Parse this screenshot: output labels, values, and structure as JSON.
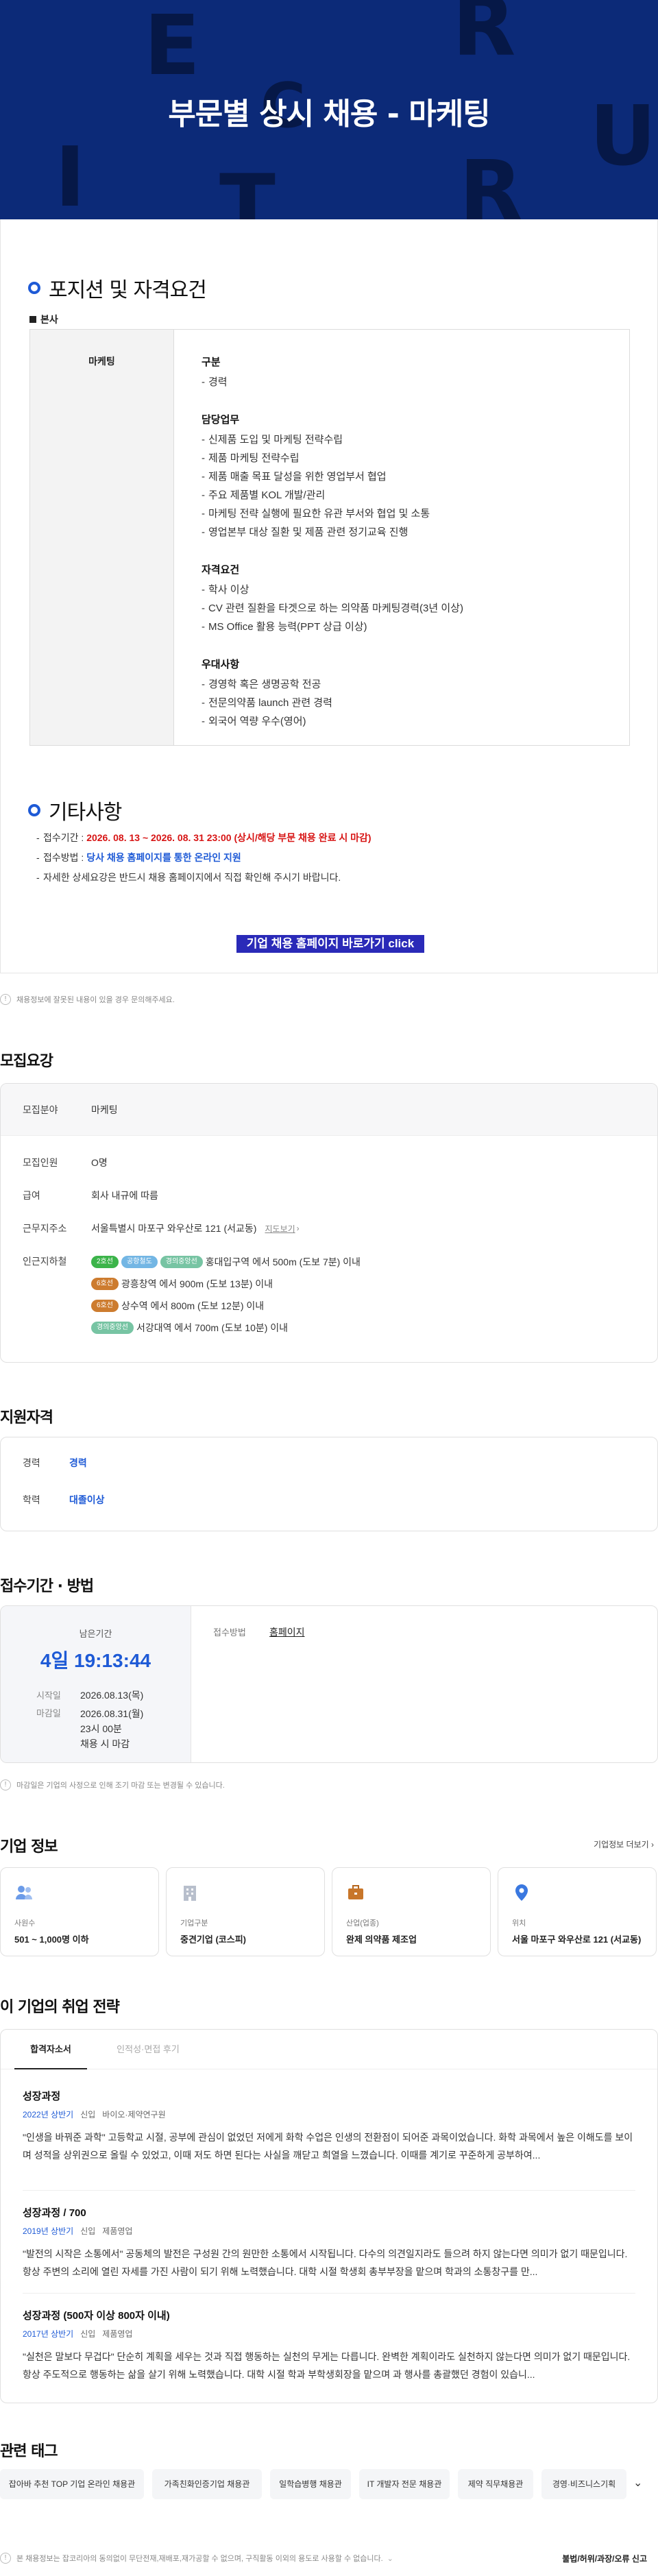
{
  "hero": {
    "title": "부문별 상시 채용 - 마케팅",
    "letters": [
      "E",
      "R",
      "C",
      "U",
      "I",
      "T",
      "R"
    ]
  },
  "positions": {
    "title": "포지션 및 자격요건",
    "division": "본사",
    "role": "마케팅",
    "groups": [
      {
        "heading": "구분",
        "items": [
          "경력"
        ]
      },
      {
        "heading": "담당업무",
        "items": [
          "신제품 도입 및 마케팅 전략수립",
          "제품 마케팅 전략수립",
          "제품 매출 목표 달성을 위한 영업부서 협업",
          "주요 제품별 KOL 개발/관리",
          "마케팅 전략 실행에 필요한 유관 부서와 협업 및 소통",
          "영업본부 대상 질환 및 제품 관련 정기교육 진행"
        ]
      },
      {
        "heading": "자격요건",
        "items": [
          "학사 이상",
          "CV 관련 질환을 타겟으로 하는 의약품 마케팅경력(3년 이상)",
          "MS Office 활용 능력(PPT 상급 이상)"
        ]
      },
      {
        "heading": "우대사항",
        "items": [
          "경영학 혹은 생명공학 전공",
          "전문의약품 launch 관련 경력",
          "외국어 역량 우수(영어)"
        ]
      }
    ]
  },
  "other": {
    "title": "기타사항",
    "period_label": "접수기간 : ",
    "period_value": "2026. 08. 13 ~ 2026. 08. 31 23:00 (상시/해당 부문 채용 완료 시 마감)",
    "method_label": "접수방법 : ",
    "method_value": "당사 채용 홈페이지를 통한 온라인 지원",
    "detail": "자세한 상세요강은 반드시 채용 홈페이지에서 직접 확인해 주시기 바랍니다.",
    "cta": "기업 채용 홈페이지 바로가기 click"
  },
  "notice_posting": "채용정보에 잘못된 내용이 있을 경우 문의해주세요.",
  "summary": {
    "title": "모집요강",
    "rows": [
      {
        "label": "모집분야",
        "value": "마케팅"
      },
      {
        "label": "모집인원",
        "value": "O명"
      },
      {
        "label": "급여",
        "value": "회사 내규에 따름"
      },
      {
        "label": "근무지주소",
        "value": "서울특별시 마포구 와우산로 121 (서교동)"
      }
    ],
    "map_link": "지도보기",
    "nearby_label": "인근지하철",
    "stations": [
      {
        "chips": [
          {
            "text": "2호선",
            "color": "#3cb44a"
          },
          {
            "text": "공항철도",
            "color": "#73b6e4"
          },
          {
            "text": "경의중앙선",
            "color": "#77c4a3"
          }
        ],
        "text": "홍대입구역 에서 500m (도보 7분) 이내"
      },
      {
        "chips": [
          {
            "text": "6호선",
            "color": "#cd7c2f"
          }
        ],
        "text": "광흥창역 에서 900m (도보 13분) 이내"
      },
      {
        "chips": [
          {
            "text": "6호선",
            "color": "#cd7c2f"
          }
        ],
        "text": "상수역 에서 800m (도보 12분) 이내"
      },
      {
        "chips": [
          {
            "text": "경의중앙선",
            "color": "#77c4a3"
          }
        ],
        "text": "서강대역 에서 700m (도보 10분) 이내"
      }
    ]
  },
  "qualification": {
    "title": "지원자격",
    "career_label": "경력",
    "career_value": "경력",
    "edu_label": "학력",
    "edu_value": "대졸이상"
  },
  "apply": {
    "title": "접수기간 · 방법",
    "remain_label": "남은기간",
    "remain_value": "4일 19:13:44",
    "start_label": "시작일",
    "start_value": "2026.08.13(목)",
    "end_label": "마감일",
    "end_value_1": "2026.08.31(월)",
    "end_value_2": "23시 00분",
    "end_value_3": "채용 시 마감",
    "method_label": "접수방법",
    "method_value": "홈페이지",
    "notice": "마감일은 기업의 사정으로 인해 조기 마감 또는 변경될 수 있습니다."
  },
  "company": {
    "title": "기업 정보",
    "more": "기업정보 더보기",
    "cards": [
      {
        "icon": "people-icon",
        "key": "사원수",
        "value": "501 ~ 1,000명 이하"
      },
      {
        "icon": "building-icon",
        "key": "기업구분",
        "value": "중견기업 (코스피)"
      },
      {
        "icon": "briefcase-icon",
        "key": "산업(업종)",
        "value": "완제 의약품 제조업"
      },
      {
        "icon": "location-icon",
        "key": "위치",
        "value": "서울 마포구 와우산로 121 (서교동)"
      }
    ]
  },
  "strategy": {
    "title": "이 기업의 취업 전략",
    "tabs": [
      "합격자소서",
      "인적성·면접 후기"
    ],
    "items": [
      {
        "title": "성장과정",
        "year": "2022년 상반기",
        "type": "신입",
        "dept": "바이오·제약연구원",
        "body": "\"인생을 바꿔준 과학\" 고등학교 시절, 공부에 관심이 없었던 저에게 화학 수업은 인생의 전환점이 되어준 과목이었습니다. 화학 과목에서 높은 이해도를 보이며 성적을 상위권으로 올릴 수 있었고, 이때 저도 하면 된다는 사실을 깨닫고 희열을 느꼈습니다. 이때를 계기로 꾸준하게 공부하여..."
      },
      {
        "title": "성장과정 / 700",
        "year": "2019년 상반기",
        "type": "신입",
        "dept": "제품영업",
        "body": "\"발전의 시작은 소통에서\" 공동체의 발전은 구성원 간의 원만한 소통에서 시작됩니다. 다수의 의견일지라도 들으려 하지 않는다면 의미가 없기 때문입니다. 항상 주변의 소리에 열린 자세를 가진 사람이 되기 위해 노력했습니다. 대학 시절 학생회 총부부장을 맡으며 학과의 소통창구를 만..."
      },
      {
        "title": "성장과정 (500자 이상 800자 이내)",
        "year": "2017년 상반기",
        "type": "신입",
        "dept": "제품영업",
        "body": "\"실천은 말보다 무겁다\" 단순히 계획을 세우는 것과 직접 행동하는 실천의 무게는 다릅니다. 완벽한 계획이라도 실천하지 않는다면 의미가 없기 때문입니다. 항상 주도적으로 행동하는 삶을 살기 위해 노력했습니다. 대학 시절 학과 부학생회장을 맡으며 과 행사를 총괄했던 경험이 있습니..."
      }
    ]
  },
  "tags": {
    "title": "관련 태그",
    "items": [
      "잡아바 추천 TOP 기업 온라인 채용관",
      "가족친화인증기업 채용관",
      "일학습병행 채용관",
      "IT 개발자 전문 채용관",
      "제약 직무채용관",
      "경영·비즈니스기획"
    ]
  },
  "footer": {
    "text": "본 채용정보는 잡코리아의 동의없이 무단전재,재배포,재가공할 수 없으며, 구직활동 이외의 용도로 사용할 수 없습니다.",
    "report": "불법/허위/과장/오류 신고"
  },
  "colors": {
    "hero_bg": "#0c2a78",
    "accent": "#1e5ad6",
    "red": "#d71414",
    "cta": "#2a2ab8"
  }
}
